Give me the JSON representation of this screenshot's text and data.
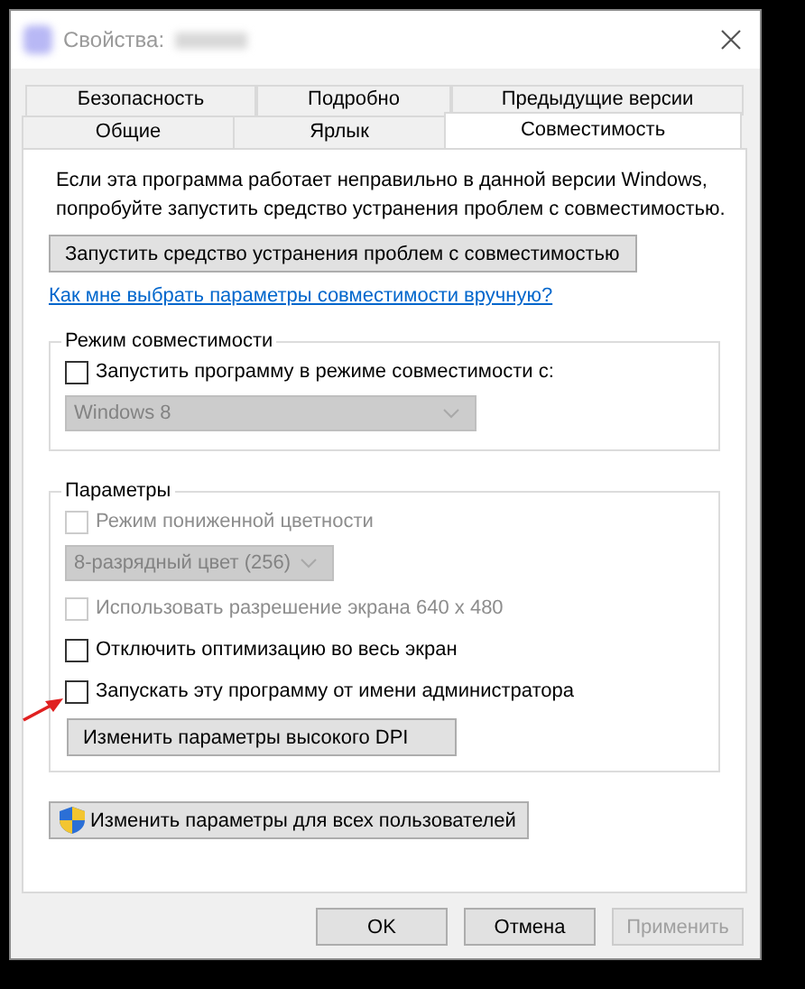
{
  "window": {
    "title": "Свойства:"
  },
  "tab_rows": [
    {
      "tabs": [
        {
          "label": "Безопасность",
          "selected": false
        },
        {
          "label": "Подробно",
          "selected": false
        },
        {
          "label": "Предыдущие версии",
          "selected": false
        }
      ]
    },
    {
      "tabs": [
        {
          "label": "Общие",
          "selected": false
        },
        {
          "label": "Ярлык",
          "selected": false
        },
        {
          "label": "Совместимость",
          "selected": true
        }
      ]
    }
  ],
  "description_lines": [
    "Если эта программа работает неправильно в данной версии Windows,",
    "попробуйте запустить средство устранения проблем с совместимостью."
  ],
  "troubleshoot_button": "Запустить средство устранения проблем с совместимостью",
  "help_link": "Как мне выбрать параметры совместимости вручную?",
  "compat_mode": {
    "title": "Режим совместимости",
    "items": [
      {
        "kind": "checkbox",
        "label": "Запустить программу в режиме совместимости с:",
        "checked": false,
        "disabled": false
      },
      {
        "kind": "dropdown",
        "value": "Windows 8",
        "disabled": true
      }
    ]
  },
  "settings": {
    "title": "Параметры",
    "items": [
      {
        "kind": "checkbox",
        "label": "Режим пониженной цветности",
        "checked": false,
        "disabled": true
      },
      {
        "kind": "dropdown",
        "value": "8-разрядный цвет (256)",
        "disabled": true
      },
      {
        "kind": "checkbox",
        "label": "Использовать разрешение экрана 640 x 480",
        "checked": false,
        "disabled": true
      },
      {
        "kind": "checkbox",
        "label": "Отключить оптимизацию во весь экран",
        "checked": false,
        "disabled": false
      },
      {
        "kind": "checkbox",
        "label": "Запускать эту программу от имени администратора",
        "checked": false,
        "disabled": false
      },
      {
        "kind": "button",
        "label": "Изменить параметры высокого DPI"
      }
    ]
  },
  "all_users_button": "Изменить параметры для всех пользователей",
  "buttons": [
    {
      "label": "OK",
      "disabled": false
    },
    {
      "label": "Отмена",
      "disabled": false
    },
    {
      "label": "Применить",
      "disabled": true
    }
  ]
}
